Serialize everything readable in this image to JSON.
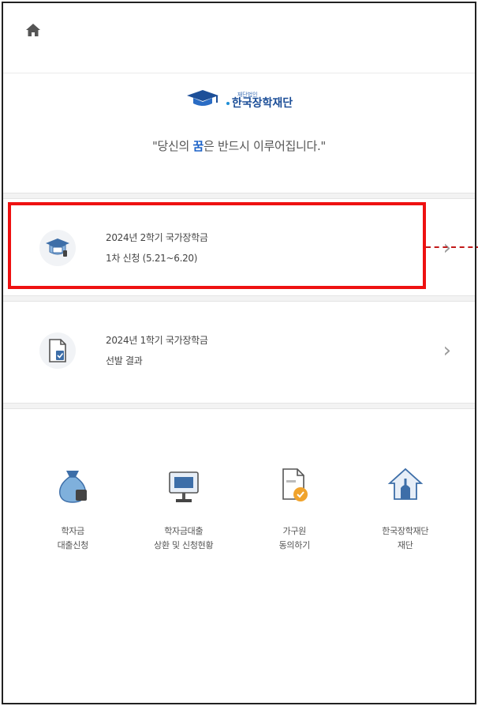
{
  "header": {
    "home_icon": "home-icon"
  },
  "brand": {
    "logo_small": "재단법인",
    "logo_main": "한국장학재단",
    "slogan_before": "\"당신의 ",
    "slogan_highlight": "꿈",
    "slogan_after": "은 반드시 이루어집니다.\"",
    "accent_color": "#1d63c8"
  },
  "menu": [
    {
      "icon": "graduation-cap-icon",
      "line1": "2024년 2학기 국가장학금",
      "line2": "1차 신청 (5.21~6.20)",
      "chevron": "›"
    },
    {
      "icon": "document-result-icon",
      "line1": "2024년 1학기 국가장학금",
      "line2": "선발 결과",
      "chevron": "›"
    }
  ],
  "quick_links": [
    {
      "icon": "money-bag-icon",
      "label": "학자금\n대출신청"
    },
    {
      "icon": "presentation-board-icon",
      "label": "학자금대출\n상환 및 신청현황"
    },
    {
      "icon": "household-consent-icon",
      "label": "가구원\n동의하기"
    },
    {
      "icon": "house-hand-icon",
      "label": "한국장학재단\n재단"
    }
  ],
  "annotation": {
    "highlight_color": "#ee1111"
  }
}
